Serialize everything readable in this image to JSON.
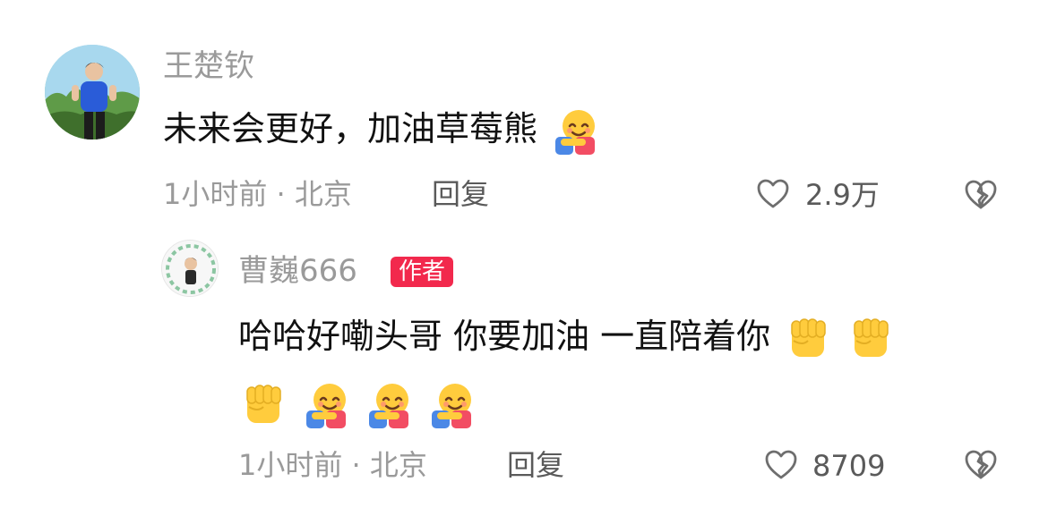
{
  "comment": {
    "username": "王楚钦",
    "text": "未来会更好，加油草莓熊",
    "text_emojis": [
      "hugging-face"
    ],
    "time_location": "1小时前 · 北京",
    "reply_label": "回复",
    "likes": "2.9万"
  },
  "reply": {
    "username": "曹巍666",
    "badge": "作者",
    "line1": "哈哈好嘞头哥 你要加油 一直陪着你",
    "line1_emojis": [
      "raised-fist",
      "raised-fist"
    ],
    "line2_emojis": [
      "raised-fist",
      "hugging-face",
      "hugging-face",
      "hugging-face"
    ],
    "time_location": "1小时前 · 北京",
    "reply_label": "回复",
    "likes": "8709"
  },
  "colors": {
    "text_primary": "#111111",
    "text_secondary": "#9a9a9a",
    "text_action": "#5a5a5a",
    "badge_bg": "#f2294d"
  }
}
